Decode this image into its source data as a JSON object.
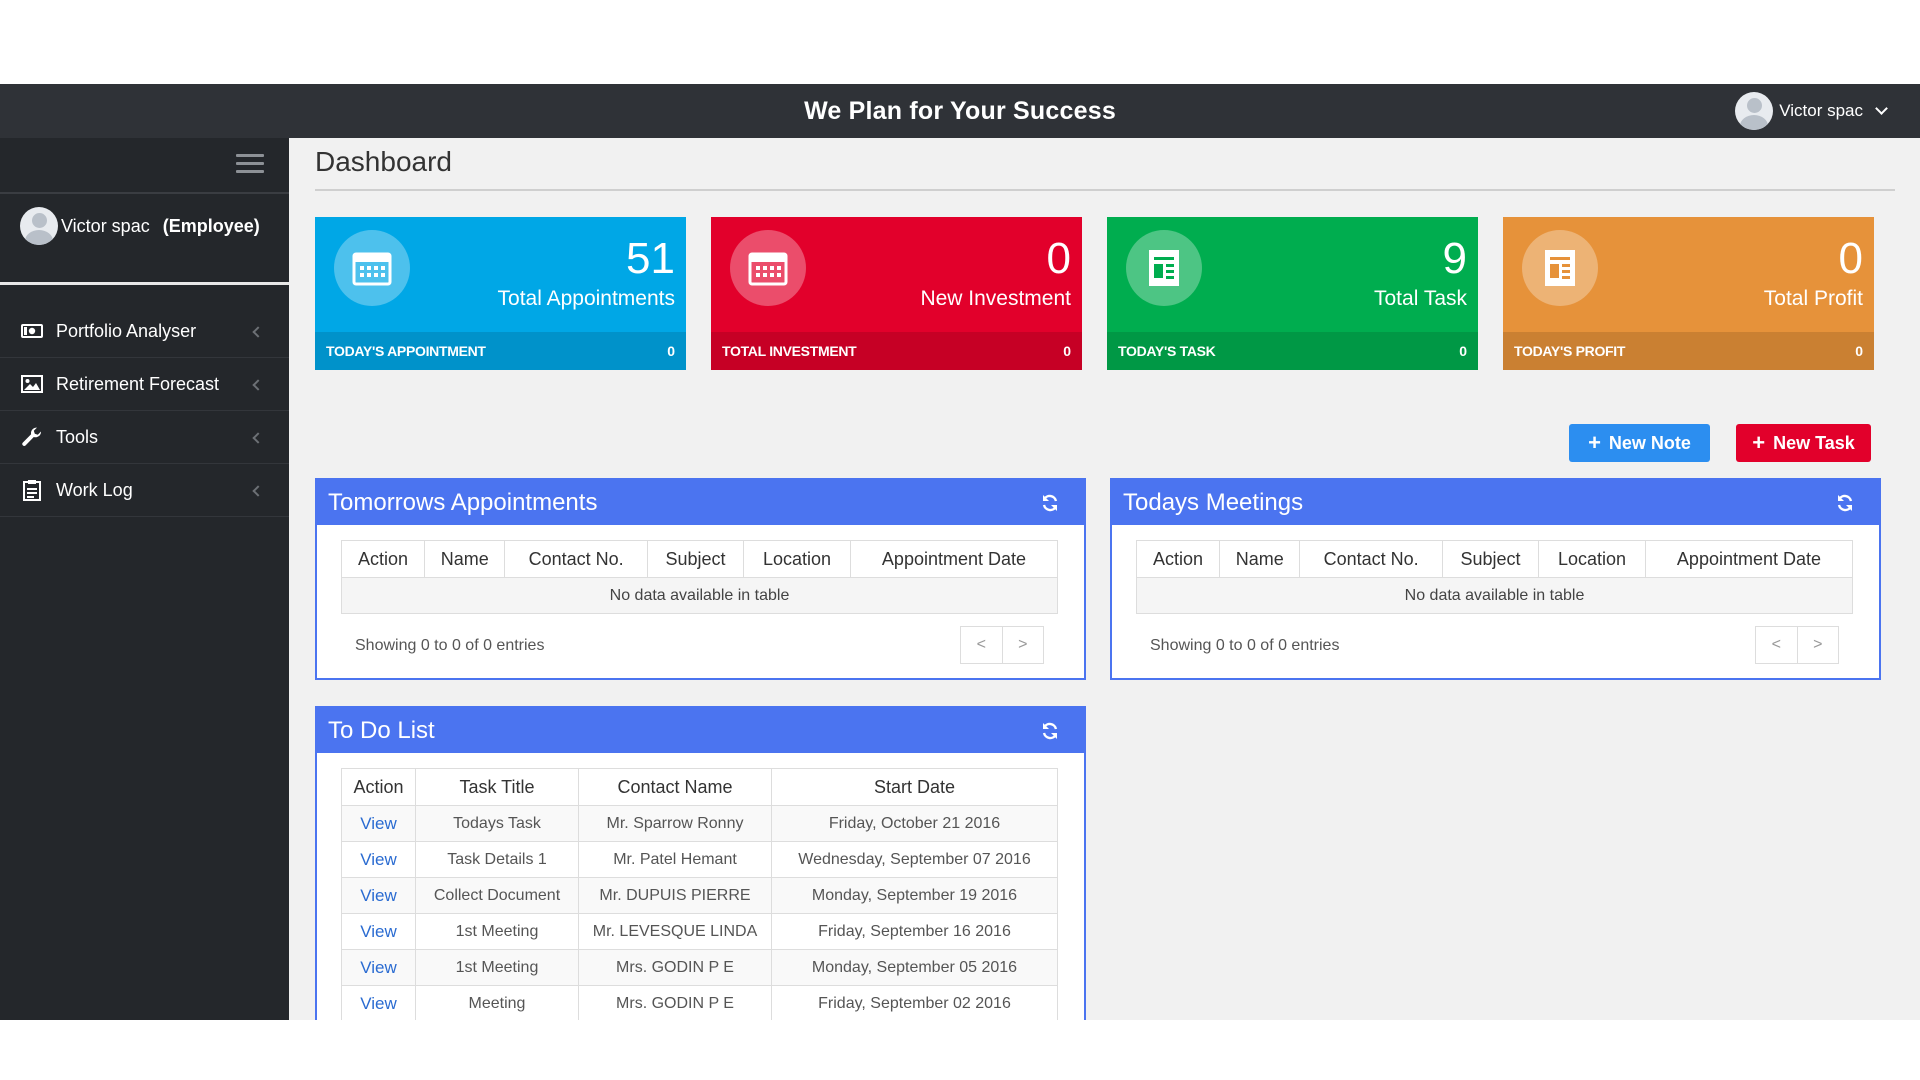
{
  "header": {
    "title": "We Plan for Your Success",
    "user_name": "Victor spac"
  },
  "sidebar": {
    "user_name": "Victor spac",
    "role": "(Employee)",
    "items": [
      {
        "label": "Portfolio Analyser",
        "icon": "money-icon"
      },
      {
        "label": "Retirement Forecast",
        "icon": "image-icon"
      },
      {
        "label": "Tools",
        "icon": "wrench-icon"
      },
      {
        "label": "Work Log",
        "icon": "clipboard-icon"
      }
    ]
  },
  "page": {
    "title": "Dashboard"
  },
  "stats": [
    {
      "value": "51",
      "label": "Total Appointments",
      "footer_label": "TODAY'S APPOINTMENT",
      "footer_value": "0",
      "color": "#00a7e6",
      "icon": "calendar-icon"
    },
    {
      "value": "0",
      "label": "New Investment",
      "footer_label": "TOTAL INVESTMENT",
      "footer_value": "0",
      "color": "#e2002b",
      "icon": "calendar-icon"
    },
    {
      "value": "9",
      "label": "Total Task",
      "footer_label": "TODAY'S TASK",
      "footer_value": "0",
      "color": "#00ad4f",
      "icon": "document-icon"
    },
    {
      "value": "0",
      "label": "Total Profit",
      "footer_label": "TODAY'S PROFIT",
      "footer_value": "0",
      "color": "#e6923a",
      "icon": "document-icon"
    }
  ],
  "buttons": {
    "new_note": {
      "label": "New Note",
      "color": "#2c8ef0"
    },
    "new_task": {
      "label": "New Task",
      "color": "#e2002b"
    }
  },
  "tomorrows_appointments": {
    "title": "Tomorrows Appointments",
    "columns": [
      "Action",
      "Name",
      "Contact No.",
      "Subject",
      "Location",
      "Appointment Date"
    ],
    "empty_text": "No data available in table",
    "showing": "Showing 0 to 0 of 0 entries",
    "prev": "<",
    "next": ">"
  },
  "todays_meetings": {
    "title": "Todays Meetings",
    "columns": [
      "Action",
      "Name",
      "Contact No.",
      "Subject",
      "Location",
      "Appointment Date"
    ],
    "empty_text": "No data available in table",
    "showing": "Showing 0 to 0 of 0 entries",
    "prev": "<",
    "next": ">"
  },
  "todo": {
    "title": "To Do List",
    "columns": [
      "Action",
      "Task Title",
      "Contact Name",
      "Start Date"
    ],
    "rows": [
      {
        "action": "View",
        "task": "Todays Task",
        "contact": "Mr. Sparrow Ronny",
        "date": "Friday, October 21 2016"
      },
      {
        "action": "View",
        "task": "Task Details 1",
        "contact": "Mr. Patel Hemant",
        "date": "Wednesday, September 07 2016"
      },
      {
        "action": "View",
        "task": "Collect Document",
        "contact": "Mr. DUPUIS PIERRE",
        "date": "Monday, September 19 2016"
      },
      {
        "action": "View",
        "task": "1st Meeting",
        "contact": "Mr. LEVESQUE LINDA",
        "date": "Friday, September 16 2016"
      },
      {
        "action": "View",
        "task": "1st Meeting",
        "contact": "Mrs. GODIN P E",
        "date": "Monday, September 05 2016"
      },
      {
        "action": "View",
        "task": "Meeting",
        "contact": "Mrs. GODIN P E",
        "date": "Friday, September 02 2016"
      }
    ]
  },
  "colors": {
    "panel_header": "#4b74f0",
    "sidebar": "#24272b",
    "topbar": "#2f3237"
  }
}
